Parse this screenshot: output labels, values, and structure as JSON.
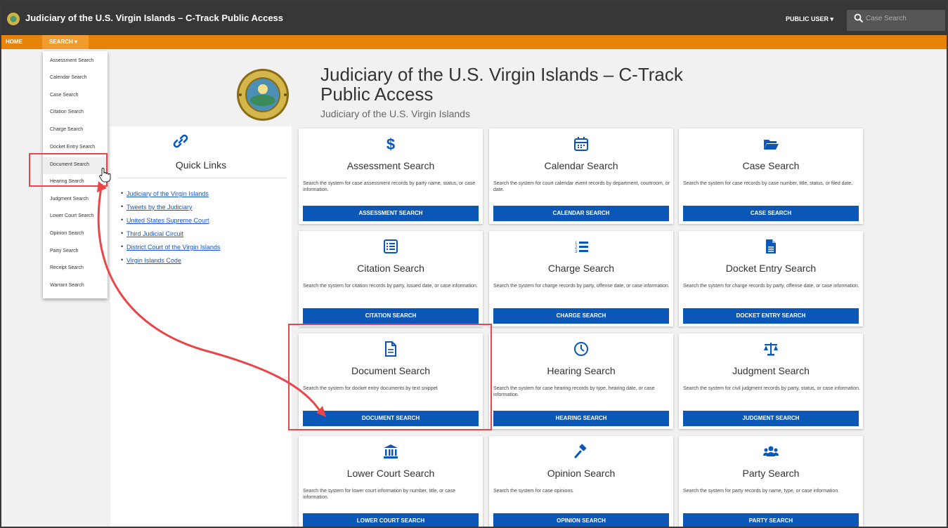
{
  "header": {
    "app_title": "Judiciary of the U.S. Virgin Islands – C-Track Public Access",
    "user_menu": "PUBLIC USER ▾",
    "search_placeholder": "Case Search"
  },
  "nav": {
    "home": "HOME",
    "search": "SEARCH ▾"
  },
  "dropdown": {
    "items": [
      "Assessment Search",
      "Calendar Search",
      "Case Search",
      "Citation Search",
      "Charge Search",
      "Docket Entry Search",
      "Document Search",
      "Hearing Search",
      "Judgment Search",
      "Lower Court Search",
      "Opinion Search",
      "Party Search",
      "Receipt Search",
      "Warrant Search"
    ]
  },
  "page": {
    "title": "Judiciary of the U.S. Virgin Islands – C-Track Public Access",
    "subtitle": "Judiciary of the U.S. Virgin Islands"
  },
  "quick_links": {
    "title": "Quick Links",
    "items": [
      "Judiciary of the Virgin Islands",
      "Tweets by the Judiciary",
      "United States Supreme Court",
      "Third Judicial Circuit",
      "District Court of the Virgin Islands",
      "Virgin Islands Code"
    ]
  },
  "cards": [
    {
      "icon": "dollar-icon",
      "title": "Assessment Search",
      "desc": "Search the system for case assessment records by party name, status, or case information.",
      "button": "ASSESSMENT SEARCH"
    },
    {
      "icon": "calendar-icon",
      "title": "Calendar Search",
      "desc": "Search the system for court calendar event records by department, courtroom, or date.",
      "button": "CALENDAR SEARCH"
    },
    {
      "icon": "folder-open-icon",
      "title": "Case Search",
      "desc": "Search the system for case records by case number, title, status, or filed date.",
      "button": "CASE SEARCH"
    },
    {
      "icon": "list-alt-icon",
      "title": "Citation Search",
      "desc": "Search the system for citation records by party, issued date, or case information.",
      "button": "CITATION SEARCH"
    },
    {
      "icon": "list-ol-icon",
      "title": "Charge Search",
      "desc": "Search the system for charge records by party, offense date, or case information.",
      "button": "CHARGE SEARCH"
    },
    {
      "icon": "file-icon",
      "title": "Docket Entry Search",
      "desc": "Search the system for charge records by party, offense date, or case information.",
      "button": "DOCKET ENTRY SEARCH"
    },
    {
      "icon": "file-text-icon",
      "title": "Document Search",
      "desc": "Search the system for docket entry documents by text snippet",
      "button": "DOCUMENT SEARCH"
    },
    {
      "icon": "clock-icon",
      "title": "Hearing Search",
      "desc": "Search the system for case hearing records by type, hearing date, or case information.",
      "button": "HEARING SEARCH"
    },
    {
      "icon": "balance-scale-icon",
      "title": "Judgment Search",
      "desc": "Search the system for civil judgment records by party, status, or case information.",
      "button": "JUDGMENT SEARCH"
    },
    {
      "icon": "landmark-icon",
      "title": "Lower Court Search",
      "desc": "Search the system for lower court information by number, title, or case information.",
      "button": "LOWER COURT SEARCH"
    },
    {
      "icon": "gavel-icon",
      "title": "Opinion Search",
      "desc": "Search the system for case opinions.",
      "button": "OPINION SEARCH"
    },
    {
      "icon": "users-icon",
      "title": "Party Search",
      "desc": "Search the system for party records by name, type, or case information.",
      "button": "PARTY SEARCH"
    }
  ],
  "colors": {
    "topbar": "#373737",
    "navbar": "#e8830a",
    "button": "#0b57b8",
    "link": "#1a56c4",
    "annotation": "#e9464a"
  }
}
